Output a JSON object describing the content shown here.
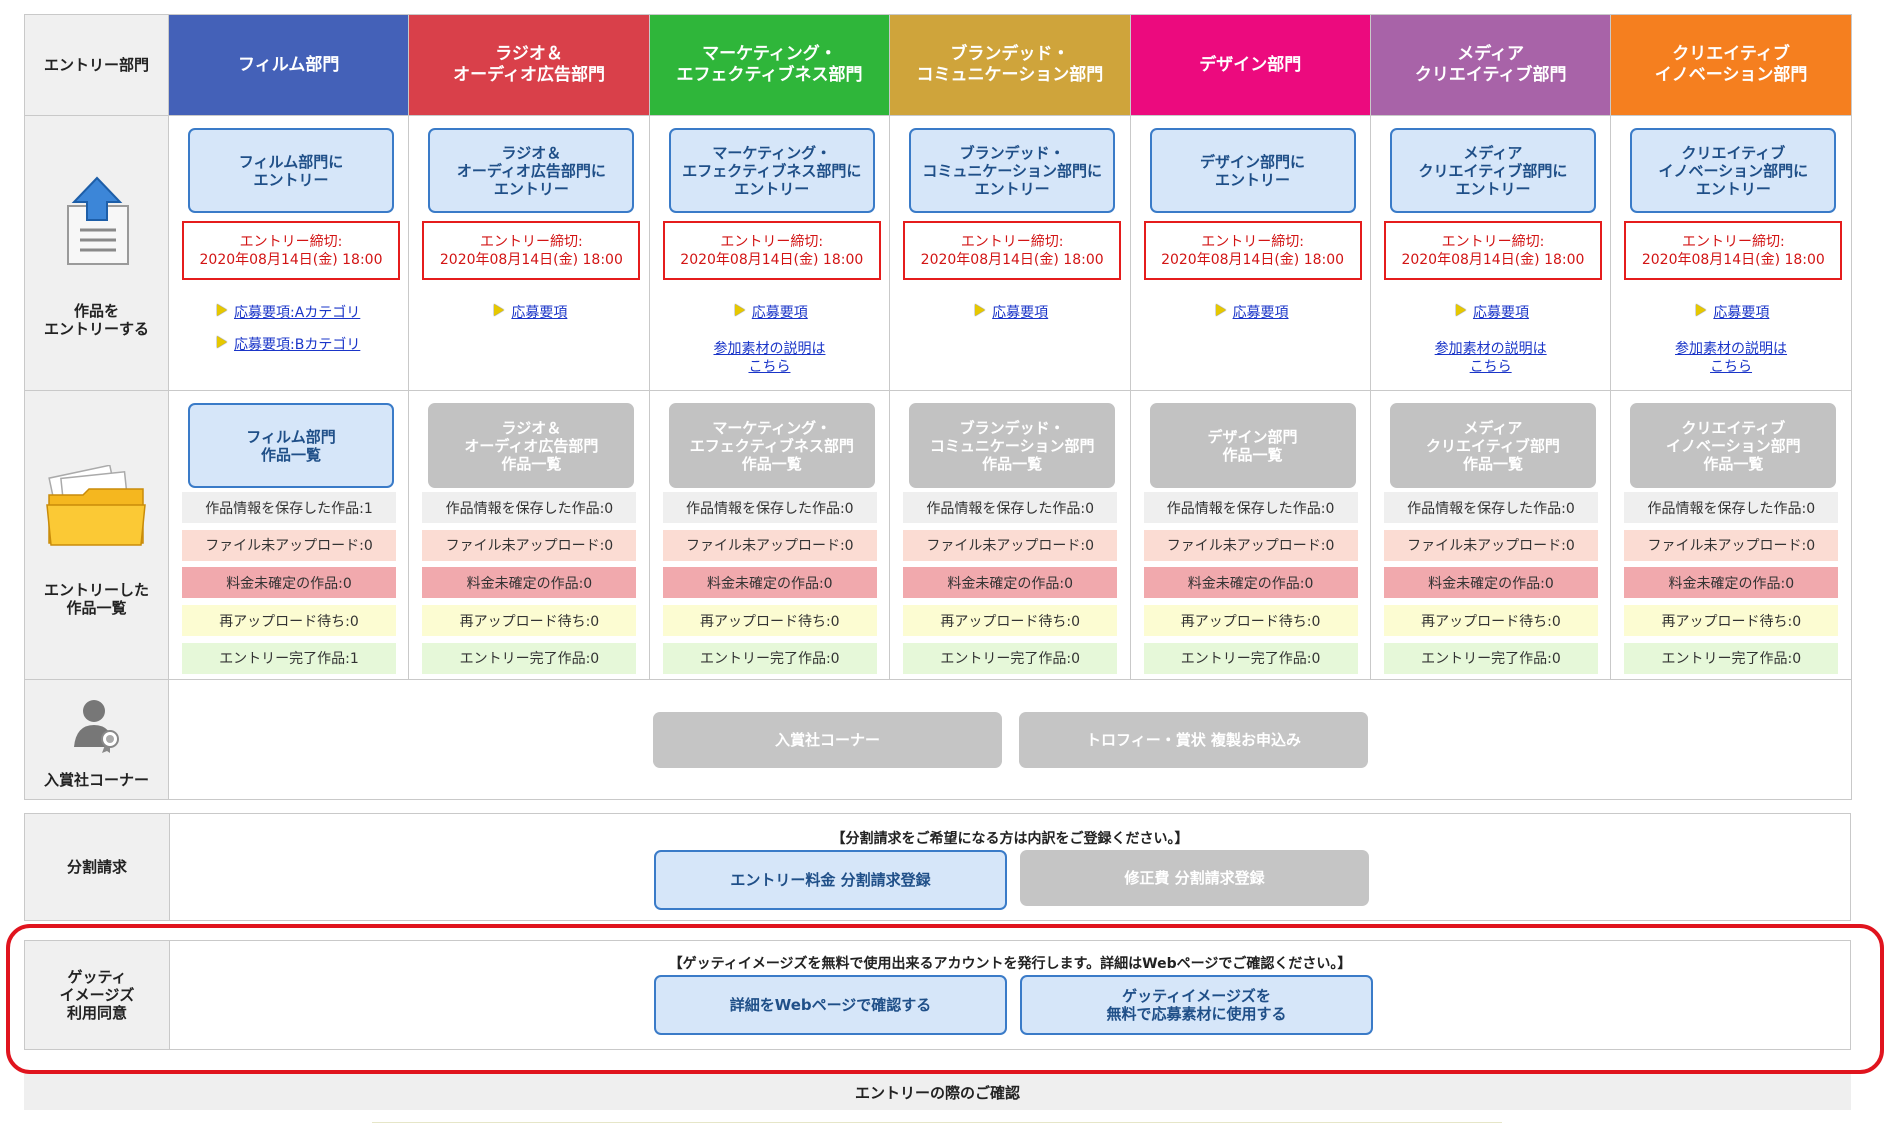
{
  "labels": {
    "entry_category": "エントリー部門",
    "entry_work": [
      "作品を",
      "エントリーする"
    ],
    "entered_list": [
      "エントリーした",
      "作品一覧"
    ],
    "winners_corner": "入賞社コーナー",
    "split_billing": "分割請求",
    "getty": [
      "ゲッティ",
      "イメージズ",
      "利用同意"
    ],
    "footer": "エントリーの際のご確認"
  },
  "categories": [
    {
      "color": "#4461b8",
      "header": [
        "フィルム部門"
      ],
      "entry_btn": [
        "フィルム部門に",
        "エントリー"
      ],
      "list_btn": [
        "フィルム部門",
        "作品一覧"
      ],
      "list_active": true,
      "guidelines": [
        "応募要項:Aカテゴリ",
        "応募要項:Bカテゴリ"
      ],
      "materials": [],
      "stats": [
        "作品情報を保存した作品:1",
        "ファイル未アップロード:0",
        "料金未確定の作品:0",
        "再アップロード待ち:0",
        "エントリー完了作品:1"
      ]
    },
    {
      "color": "#d9404a",
      "header": [
        "ラジオ＆",
        "オーディオ広告部門"
      ],
      "entry_btn": [
        "ラジオ＆",
        "オーディオ広告部門に",
        "エントリー"
      ],
      "list_btn": [
        "ラジオ＆",
        "オーディオ広告部門",
        "作品一覧"
      ],
      "list_active": false,
      "guidelines": [
        "応募要項"
      ],
      "materials": [],
      "stats": [
        "作品情報を保存した作品:0",
        "ファイル未アップロード:0",
        "料金未確定の作品:0",
        "再アップロード待ち:0",
        "エントリー完了作品:0"
      ]
    },
    {
      "color": "#2fb63a",
      "header": [
        "マーケティング・",
        "エフェクティブネス部門"
      ],
      "entry_btn": [
        "マーケティング・",
        "エフェクティブネス部門に",
        "エントリー"
      ],
      "list_btn": [
        "マーケティング・",
        "エフェクティブネス部門",
        "作品一覧"
      ],
      "list_active": false,
      "guidelines": [
        "応募要項"
      ],
      "materials": [
        "参加素材の説明は",
        "こちら"
      ],
      "stats": [
        "作品情報を保存した作品:0",
        "ファイル未アップロード:0",
        "料金未確定の作品:0",
        "再アップロード待ち:0",
        "エントリー完了作品:0"
      ]
    },
    {
      "color": "#cfa43b",
      "header": [
        "ブランデッド・",
        "コミュニケーション部門"
      ],
      "entry_btn": [
        "ブランデッド・",
        "コミュニケーション部門に",
        "エントリー"
      ],
      "list_btn": [
        "ブランデッド・",
        "コミュニケーション部門",
        "作品一覧"
      ],
      "list_active": false,
      "guidelines": [
        "応募要項"
      ],
      "materials": [],
      "stats": [
        "作品情報を保存した作品:0",
        "ファイル未アップロード:0",
        "料金未確定の作品:0",
        "再アップロード待ち:0",
        "エントリー完了作品:0"
      ]
    },
    {
      "color": "#ec0a7e",
      "header": [
        "デザイン部門"
      ],
      "entry_btn": [
        "デザイン部門に",
        "エントリー"
      ],
      "list_btn": [
        "デザイン部門",
        "作品一覧"
      ],
      "list_active": false,
      "guidelines": [
        "応募要項"
      ],
      "materials": [],
      "stats": [
        "作品情報を保存した作品:0",
        "ファイル未アップロード:0",
        "料金未確定の作品:0",
        "再アップロード待ち:0",
        "エントリー完了作品:0"
      ]
    },
    {
      "color": "#a863a8",
      "header": [
        "メディア",
        "クリエイティブ部門"
      ],
      "entry_btn": [
        "メディア",
        "クリエイティブ部門に",
        "エントリー"
      ],
      "list_btn": [
        "メディア",
        "クリエイティブ部門",
        "作品一覧"
      ],
      "list_active": false,
      "guidelines": [
        "応募要項"
      ],
      "materials": [
        "参加素材の説明は",
        "こちら"
      ],
      "stats": [
        "作品情報を保存した作品:0",
        "ファイル未アップロード:0",
        "料金未確定の作品:0",
        "再アップロード待ち:0",
        "エントリー完了作品:0"
      ]
    },
    {
      "color": "#f57f1f",
      "header": [
        "クリエイティブ",
        "イノベーション部門"
      ],
      "entry_btn": [
        "クリエイティブ",
        "イノベーション部門に",
        "エントリー"
      ],
      "list_btn": [
        "クリエイティブ",
        "イノベーション部門",
        "作品一覧"
      ],
      "list_active": false,
      "guidelines": [
        "応募要項"
      ],
      "materials": [
        "参加素材の説明は",
        "こちら"
      ],
      "stats": [
        "作品情報を保存した作品:0",
        "ファイル未アップロード:0",
        "料金未確定の作品:0",
        "再アップロード待ち:0",
        "エントリー完了作品:0"
      ]
    }
  ],
  "deadline": [
    "エントリー締切:",
    "2020年08月14日(金) 18:00"
  ],
  "winners": {
    "corner_btn": "入賞社コーナー",
    "trophy_btn": "トロフィー・賞状 複製お申込み"
  },
  "split": {
    "note": "【分割請求をご希望になる方は内訳をご登録ください。】",
    "entry_fee_btn": "エントリー料金 分割請求登録",
    "correction_btn": "修正費 分割請求登録"
  },
  "getty": {
    "note": "【ゲッティイメージズを無料で使用出来るアカウントを発行します。詳細はWebページでご確認ください。】",
    "web_btn": "詳細をWebページで確認する",
    "use_btn": [
      "ゲッティイメージズを",
      "無料で応募素材に使用する"
    ]
  },
  "colors": {
    "highlight": "#e0141e",
    "blue_border": "#3a7bc8"
  }
}
